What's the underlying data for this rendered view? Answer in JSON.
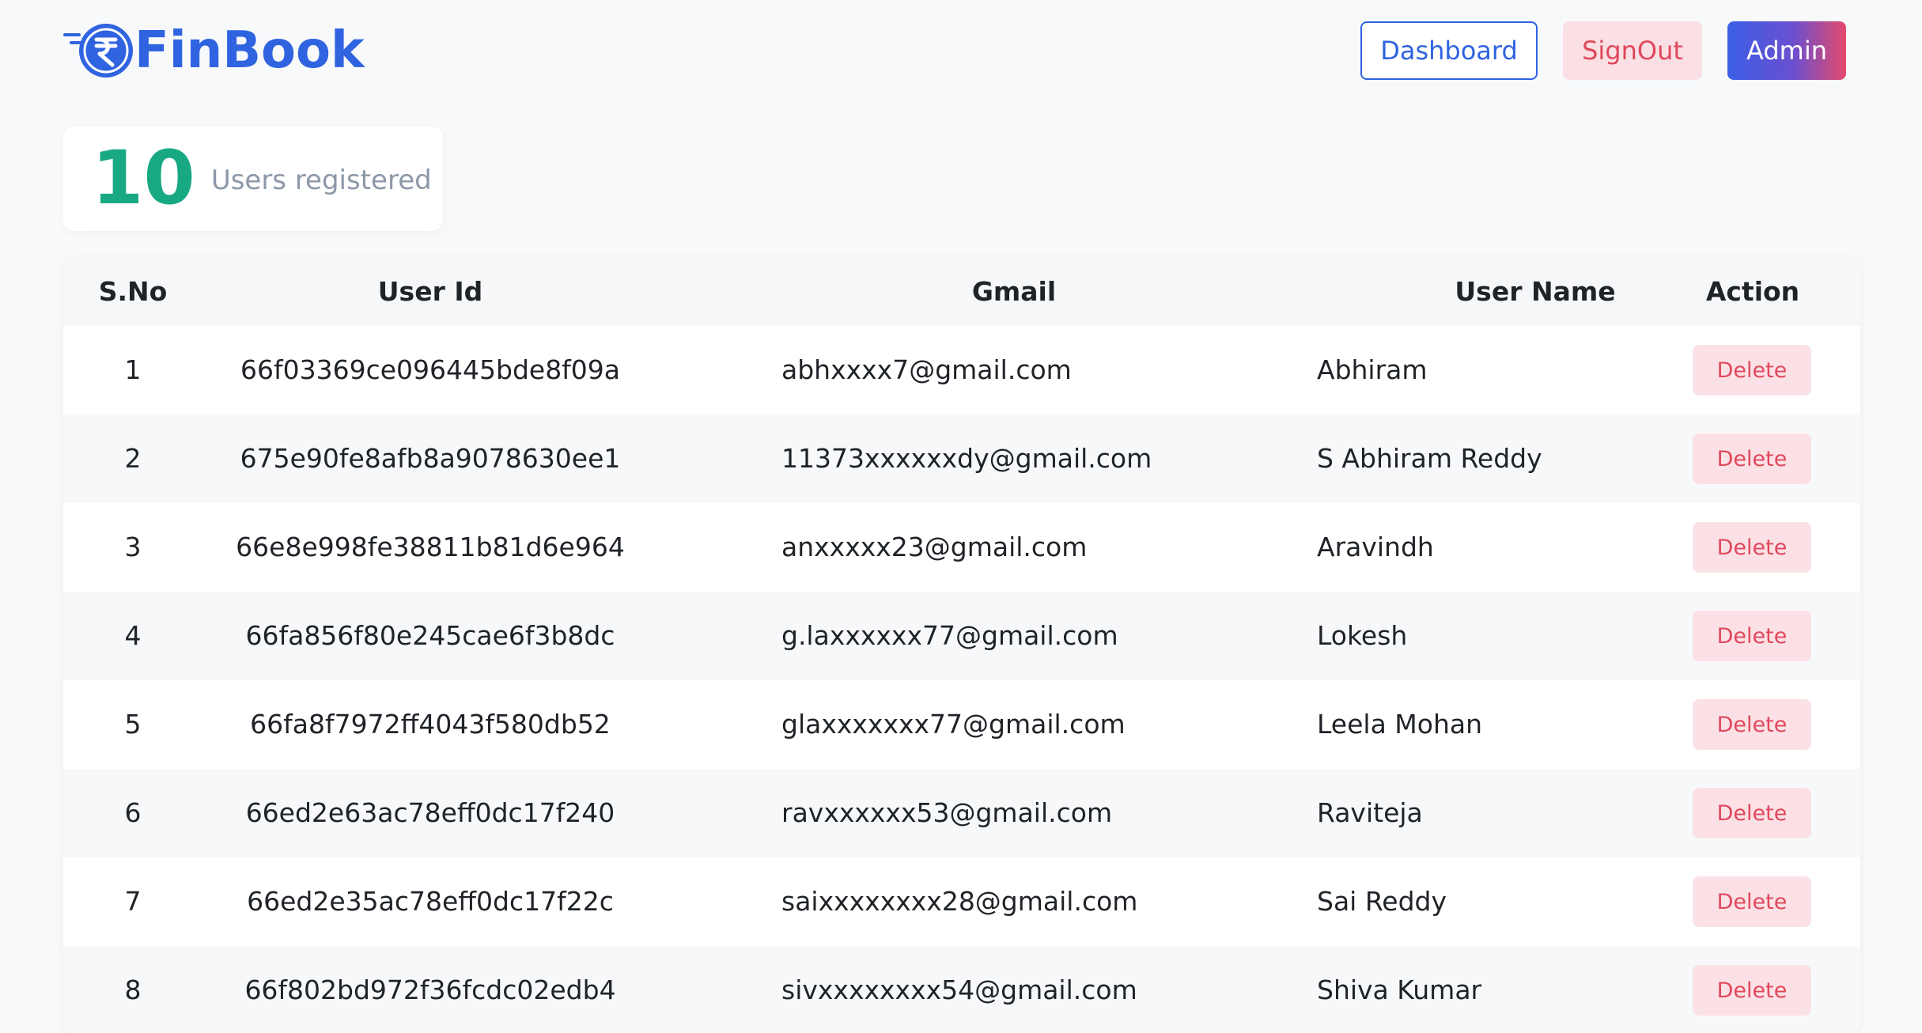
{
  "brand": {
    "name": "FinBook",
    "logo_icon": "rupee-coin-icon",
    "color": "#2f63e0"
  },
  "nav": {
    "dashboard_label": "Dashboard",
    "signout_label": "SignOut",
    "admin_label": "Admin"
  },
  "stats": {
    "count": "10",
    "label": "Users registered",
    "color": "#18a983"
  },
  "table": {
    "headers": {
      "sno": "S.No",
      "user_id": "User Id",
      "gmail": "Gmail",
      "user_name": "User Name",
      "action": "Action"
    },
    "delete_label": "Delete",
    "rows": [
      {
        "sno": "1",
        "user_id": "66f03369ce096445bde8f09a",
        "gmail": "abhxxxx7@gmail.com",
        "user_name": "Abhiram"
      },
      {
        "sno": "2",
        "user_id": "675e90fe8afb8a9078630ee1",
        "gmail": "11373xxxxxxdy@gmail.com",
        "user_name": "S Abhiram Reddy"
      },
      {
        "sno": "3",
        "user_id": "66e8e998fe38811b81d6e964",
        "gmail": "anxxxxx23@gmail.com",
        "user_name": "Aravindh"
      },
      {
        "sno": "4",
        "user_id": "66fa856f80e245cae6f3b8dc",
        "gmail": "g.laxxxxxx77@gmail.com",
        "user_name": "Lokesh"
      },
      {
        "sno": "5",
        "user_id": "66fa8f7972ff4043f580db52",
        "gmail": "glaxxxxxxx77@gmail.com",
        "user_name": "Leela Mohan"
      },
      {
        "sno": "6",
        "user_id": "66ed2e63ac78eff0dc17f240",
        "gmail": "ravxxxxxx53@gmail.com",
        "user_name": "Raviteja"
      },
      {
        "sno": "7",
        "user_id": "66ed2e35ac78eff0dc17f22c",
        "gmail": "saixxxxxxxx28@gmail.com",
        "user_name": "Sai Reddy"
      },
      {
        "sno": "8",
        "user_id": "66f802bd972f36fcdc02edb4",
        "gmail": "sivxxxxxxxx54@gmail.com",
        "user_name": "Shiva Kumar"
      }
    ]
  }
}
